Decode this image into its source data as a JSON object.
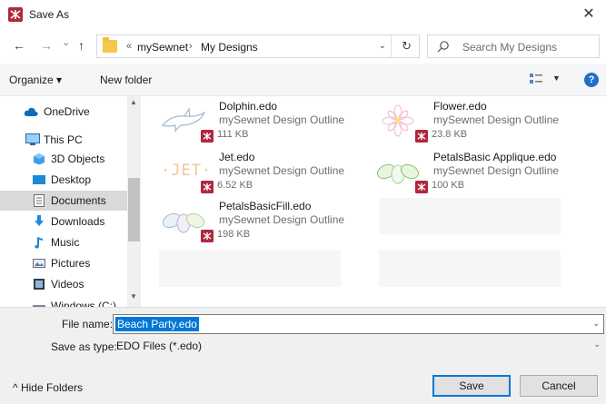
{
  "window": {
    "title": "Save As",
    "close_glyph": "✕"
  },
  "nav_buttons": {
    "back": "←",
    "forward": "→",
    "recent": "⌄",
    "up": "↑"
  },
  "address": {
    "prefix": "«",
    "parts": [
      "mySewnet",
      "My Designs"
    ],
    "separator": "›",
    "dropdown": "⌄",
    "refresh": "↻"
  },
  "search": {
    "placeholder": "Search My Designs"
  },
  "toolbar": {
    "organize_label": "Organize ▾",
    "new_folder_label": "New folder",
    "view_drop": "▼",
    "help_label": "?"
  },
  "sidebar": {
    "items": [
      {
        "label": "OneDrive",
        "icon": "cloud-icon"
      },
      {
        "label": "This PC",
        "icon": "computer-icon"
      },
      {
        "label": "3D Objects",
        "icon": "cube-icon"
      },
      {
        "label": "Desktop",
        "icon": "desktop-icon"
      },
      {
        "label": "Documents",
        "icon": "document-icon",
        "selected": true
      },
      {
        "label": "Downloads",
        "icon": "download-icon"
      },
      {
        "label": "Music",
        "icon": "music-icon"
      },
      {
        "label": "Pictures",
        "icon": "pictures-icon"
      },
      {
        "label": "Videos",
        "icon": "videos-icon"
      },
      {
        "label": "Windows (C:)",
        "icon": "drive-icon"
      }
    ],
    "scroll_up": "▲",
    "scroll_down": "▼"
  },
  "files": [
    {
      "name": "Dolphin.edo",
      "type": "mySewnet Design Outline",
      "size": "111 KB"
    },
    {
      "name": "Flower.edo",
      "type": "mySewnet Design Outline",
      "size": "23.8 KB"
    },
    {
      "name": "Jet.edo",
      "type": "mySewnet Design Outline",
      "size": "6.52 KB"
    },
    {
      "name": "PetalsBasic Applique.edo",
      "type": "mySewnet Design Outline",
      "size": "100 KB"
    },
    {
      "name": "PetalsBasicFill.edo",
      "type": "mySewnet Design Outline",
      "size": "198 KB"
    }
  ],
  "jet_thumb_text": "·JET·",
  "form": {
    "file_name_label": "File name:",
    "file_name_value": "Beach Party.edo",
    "save_type_label": "Save as type:",
    "save_type_value": "EDO Files (*.edo)",
    "dropdown": "⌄"
  },
  "footer": {
    "hide_folders": "^ Hide Folders",
    "save_label": "Save",
    "cancel_label": "Cancel"
  },
  "colors": {
    "accent": "#0078d7",
    "app_icon": "#b0283e",
    "folder": "#f4c84c"
  }
}
